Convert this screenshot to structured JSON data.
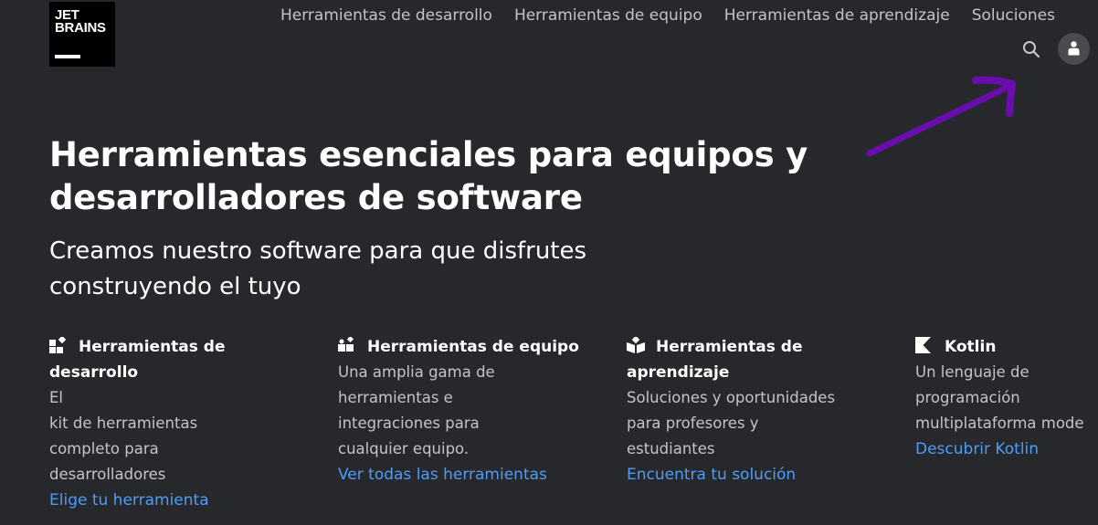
{
  "brand": {
    "logo_text": "JET\nBRAINS"
  },
  "nav": {
    "items": [
      "Herramientas de desarrollo",
      "Herramientas de equipo",
      "Herramientas de aprendizaje",
      "Soluciones"
    ]
  },
  "hero": {
    "title_line1": "Herramientas esenciales para equipos y",
    "title_line2": "desarrolladores de software",
    "subtitle_line1": "Creamos nuestro software para que disfrutes",
    "subtitle_line2": "construyendo el tuyo"
  },
  "columns": [
    {
      "icon": "dev-tools-icon",
      "title_line1": "Herramientas de",
      "title_line2": "desarrollo",
      "desc_lines": [
        "El",
        "kit de herramientas",
        "completo para",
        "desarrolladores"
      ],
      "link": "Elige tu herramienta"
    },
    {
      "icon": "team-tools-icon",
      "title_line1": "Herramientas de equipo",
      "title_line2": "",
      "desc_lines": [
        "Una amplia gama de",
        "herramientas e",
        "integraciones para",
        "cualquier equipo."
      ],
      "link": "Ver todas las herramientas"
    },
    {
      "icon": "book-icon",
      "title_line1": "Herramientas de",
      "title_line2": "aprendizaje",
      "desc_lines": [
        "Soluciones y oportunidades",
        "para profesores y",
        "estudiantes"
      ],
      "link": "Encuentra tu solución"
    },
    {
      "icon": "kotlin-icon",
      "title_line1": "Kotlin",
      "title_line2": "",
      "desc_lines": [
        "Un lenguaje de",
        "programación",
        "multiplataforma mode"
      ],
      "link": "Descubrir Kotlin"
    }
  ],
  "colors": {
    "background": "#27282c",
    "link": "#4f9cf5",
    "annotation_arrow": "#6a0dad"
  }
}
